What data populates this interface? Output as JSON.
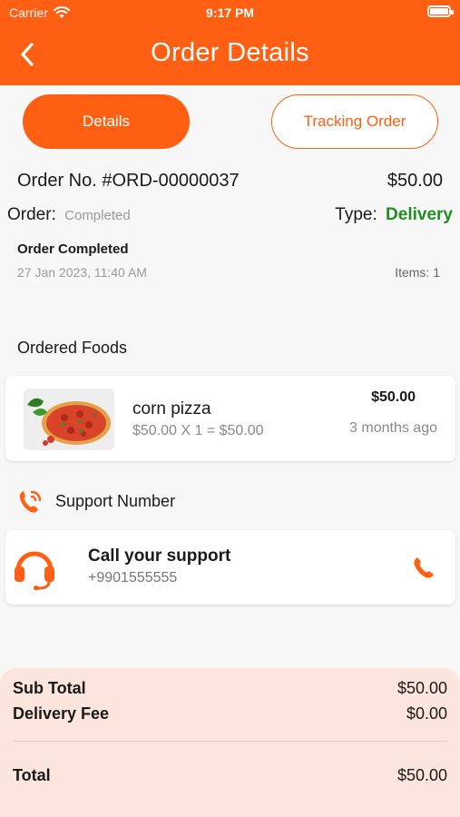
{
  "status_bar": {
    "carrier": "Carrier",
    "time": "9:17 PM",
    "battery_level": 1.0
  },
  "header": {
    "title": "Order Details"
  },
  "tabs": [
    {
      "label": "Details",
      "active": true
    },
    {
      "label": "Tracking Order",
      "active": false
    }
  ],
  "order": {
    "number": "Order No. #ORD-00000037",
    "amount": "$50.00",
    "status_label": "Order:",
    "status_value": "Completed",
    "type_label": "Type:",
    "type_value": "Delivery",
    "completed_title": "Order Completed",
    "completed_date": "27 Jan 2023, 11:40 AM",
    "items_count": "Items: 1"
  },
  "ordered_foods": {
    "title": "Ordered Foods",
    "items": [
      {
        "name": "corn pizza",
        "calc": "$50.00 X 1 = $50.00",
        "price": "$50.00",
        "time": "3 months ago"
      }
    ]
  },
  "support": {
    "title": "Support Number",
    "card_title": "Call your support",
    "phone": "+9901555555"
  },
  "summary": {
    "subtotal_label": "Sub Total",
    "subtotal_value": "$50.00",
    "delivery_label": "Delivery Fee",
    "delivery_value": "$0.00",
    "total_label": "Total",
    "total_value": "$50.00"
  },
  "colors": {
    "accent": "#ff5f13",
    "type_green": "#1f8f1f",
    "summary_bg": "#fbe5dc"
  }
}
